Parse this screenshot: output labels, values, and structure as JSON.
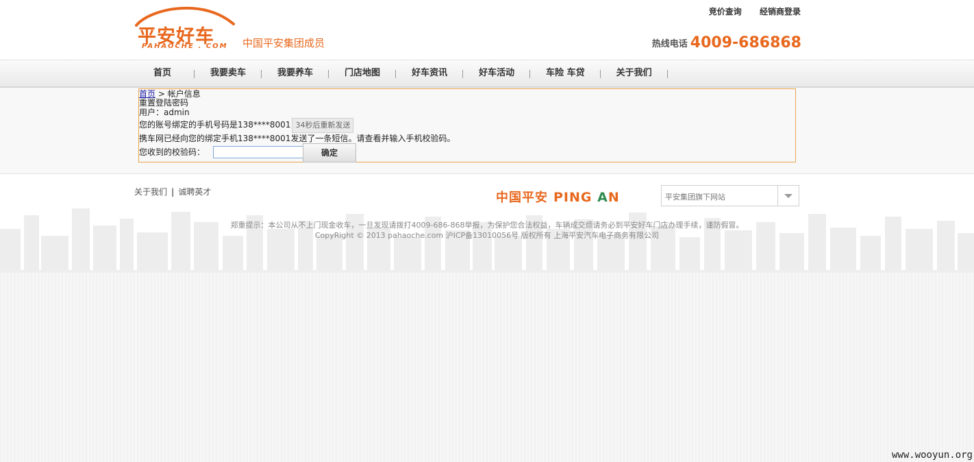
{
  "header": {
    "logo_main": "平安好车",
    "logo_sub": "PAHAOCHE . COM",
    "tagline": "中国平安集团成员",
    "top_links": [
      "竞价查询",
      "经销商登录"
    ],
    "hotline_label": "热线电话",
    "hotline_number": "4009-686868",
    "brand_color": "#e8681e"
  },
  "nav": {
    "items": [
      "首页",
      "我要卖车",
      "我要养车",
      "门店地图",
      "好车资讯",
      "好车活动",
      "车险 车贷",
      "关于我们"
    ]
  },
  "content": {
    "breadcrumb_home": "首页",
    "breadcrumb_rest": " > 帐户信息",
    "title": "重置登陆密码",
    "user_line": "用户：admin",
    "phone_line": "您的账号绑定的手机号码是138****8001",
    "resend_label": "34秒后重新发送",
    "sms_line": "携车网已经向您的绑定手机138****8001发送了一条短信。请查看并输入手机校验码。",
    "code_label": "您收到的校验码：",
    "code_value": "",
    "confirm_label": "确定"
  },
  "footer": {
    "links": [
      "关于我们",
      "诚聘英才"
    ],
    "separator": "|",
    "pingan_cn": "中国平安",
    "pingan_en_1": "PING",
    "pingan_en_2": "A",
    "pingan_en_3": "N",
    "site_select": "平安集团旗下网站",
    "notice": "郑重提示：本公司从不上门现金收车，一旦发现请拨打4009-686-868举报，为保护您合法权益，车辆成交烦请务必到平安好车门店办理手续，谨防假冒。",
    "copyright": "CopyRight © 2013 pahaoche.com 沪ICP备13010056号 版权所有 上海平安汽车电子商务有限公司"
  },
  "watermark": "www.wooyun.org"
}
